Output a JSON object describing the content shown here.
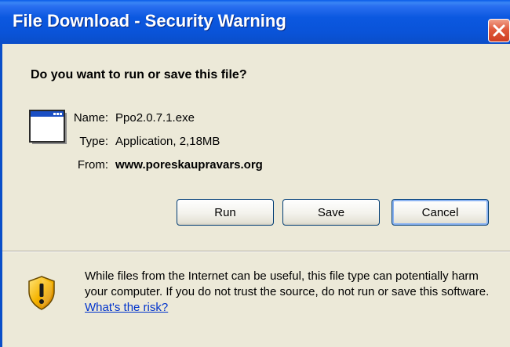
{
  "window": {
    "title": "File Download - Security Warning"
  },
  "dialog": {
    "heading": "Do you want to run or save this file?",
    "file_icon": "application-window-icon",
    "fields": {
      "name_label": "Name:",
      "name_value": "Ppo2.0.7.1.exe",
      "type_label": "Type:",
      "type_value": "Application, 2,18MB",
      "from_label": "From:",
      "from_value": "www.poreskaupravars.org"
    },
    "buttons": {
      "run": "Run",
      "save": "Save",
      "cancel": "Cancel"
    },
    "warning": {
      "icon": "security-shield-icon",
      "text": "While files from the Internet can be useful, this file type can potentially harm your computer. If you do not trust the source, do not run or save this software.",
      "link": "What's the risk?"
    }
  },
  "colors": {
    "titlebar": "#0a53d8",
    "close_button": "#e05a3c",
    "background": "#ece9d8",
    "link": "#0033cc",
    "default_button_focus": "#8cb4f2"
  }
}
